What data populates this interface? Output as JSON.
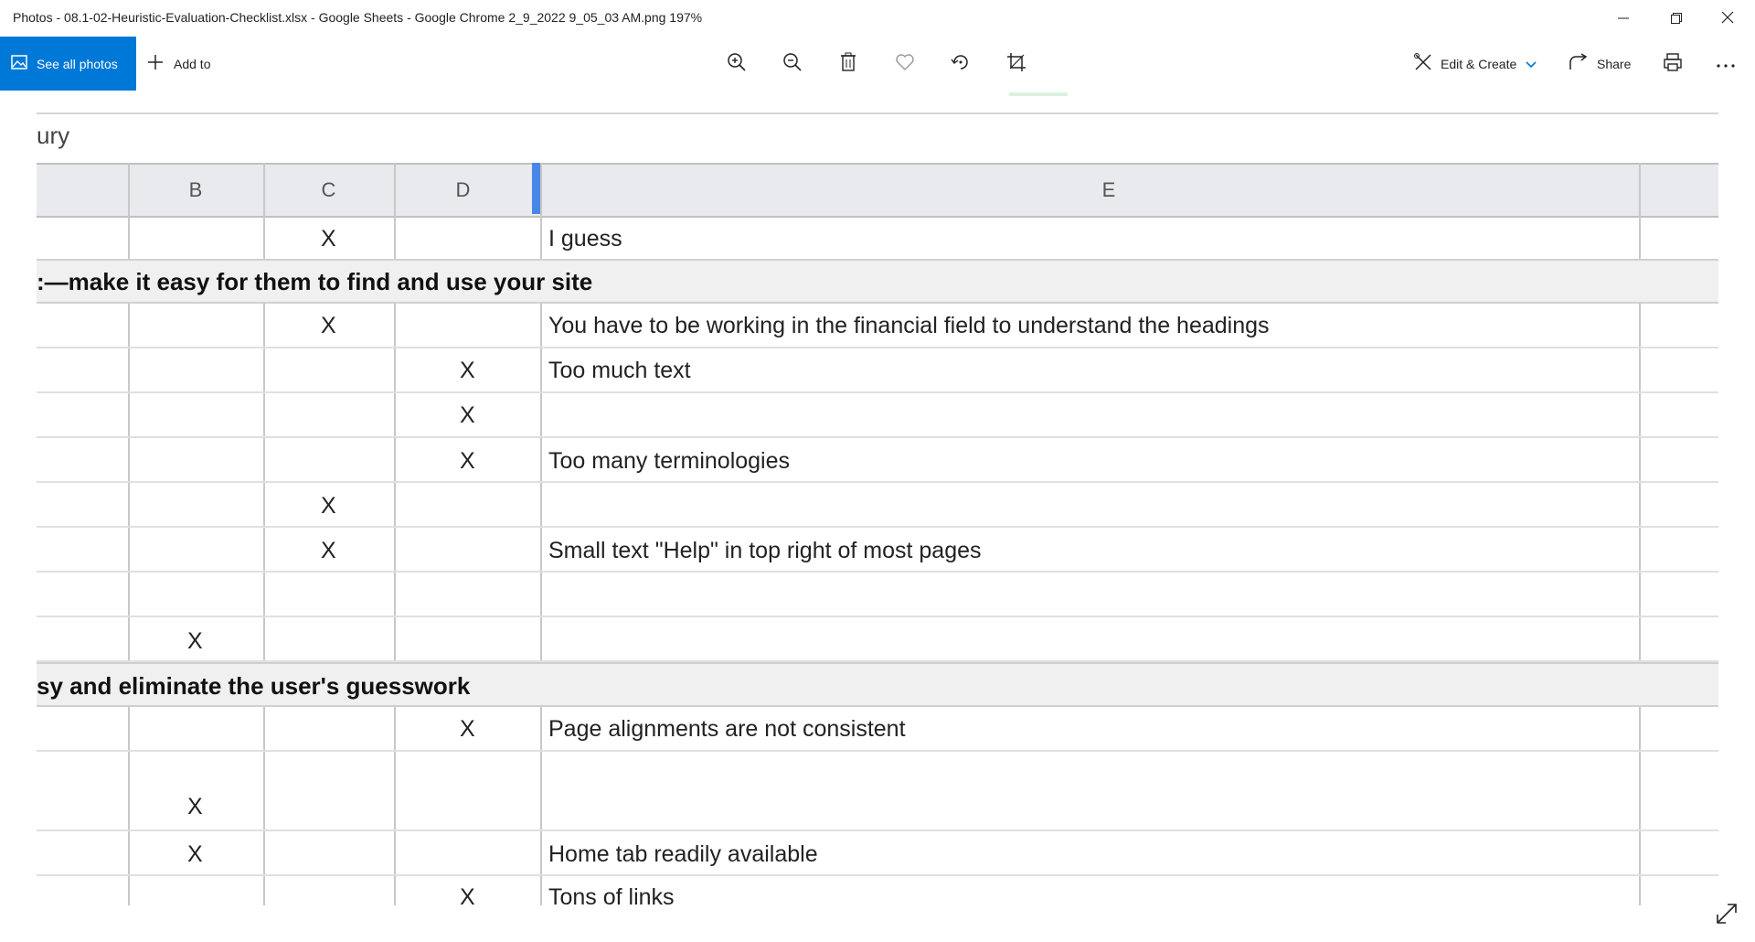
{
  "window": {
    "title": "Photos - 08.1-02-Heuristic-Evaluation-Checklist.xlsx - Google Sheets - Google Chrome 2_9_2022 9_05_03 AM.png   197%"
  },
  "toolbar": {
    "see_all_label": "See all photos",
    "add_to_label": "Add to",
    "edit_create_label": "Edit & Create",
    "share_label": "Share",
    "accent": "#0078d7"
  },
  "sheet": {
    "partial_title": "ury",
    "columns": [
      "B",
      "C",
      "D",
      "E"
    ],
    "rows": [
      {
        "kind": "data",
        "c": "X",
        "e": "I guess"
      },
      {
        "kind": "section",
        "title": ":—make it easy for them to find and use your site"
      },
      {
        "kind": "data",
        "c": "X",
        "e": "You have to be working in the financial field to understand the headings"
      },
      {
        "kind": "data",
        "d": "X",
        "e": "Too much text"
      },
      {
        "kind": "data",
        "d": "X",
        "e": ""
      },
      {
        "kind": "data",
        "d": "X",
        "e": "Too many terminologies"
      },
      {
        "kind": "data",
        "c": "X",
        "e": ""
      },
      {
        "kind": "data",
        "c": "X",
        "e": "Small text \"Help\" in top right of most pages"
      },
      {
        "kind": "data",
        "e": ""
      },
      {
        "kind": "data",
        "b": "X",
        "e": ""
      },
      {
        "kind": "section",
        "title": "sy and eliminate the user's guesswork"
      },
      {
        "kind": "data",
        "d": "X",
        "e": "Page alignments are not consistent"
      },
      {
        "kind": "data",
        "b": "X",
        "e": ""
      },
      {
        "kind": "data",
        "b": "X",
        "e": "Home tab readily available"
      },
      {
        "kind": "data",
        "d": "X",
        "e": "Tons of links"
      }
    ]
  }
}
